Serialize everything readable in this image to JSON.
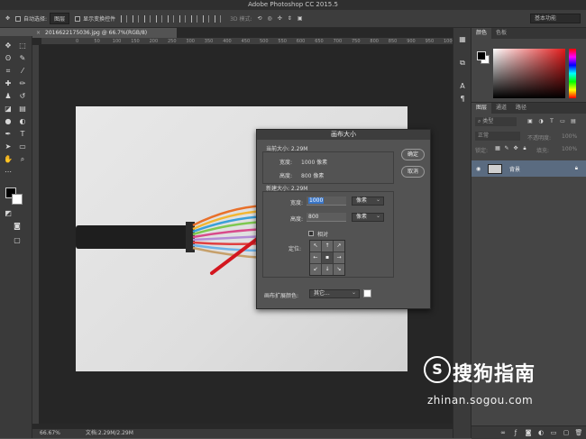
{
  "app": {
    "title": "Adobe Photoshop CC 2015.5"
  },
  "options_bar": {
    "auto_select_label": "自动选择:",
    "auto_select_value": "图层",
    "show_transform_label": "显示变换控件",
    "mode_label": "3D 模式:",
    "workspace": "基本功能"
  },
  "document": {
    "tab_title": "2016622175036.jpg @ 66.7%(RGB/8)",
    "close_glyph": "×",
    "ruler_marks": [
      "0",
      "50",
      "100",
      "150",
      "200",
      "250",
      "300",
      "350",
      "400",
      "450",
      "500",
      "550",
      "600",
      "650",
      "700",
      "750",
      "800",
      "850",
      "900",
      "950",
      "1000",
      "1050"
    ]
  },
  "status": {
    "zoom": "66.67%",
    "doc_size": "文档:2.29M/2.29M"
  },
  "panels": {
    "color_tabs": [
      "颜色",
      "色板"
    ],
    "layers_tabs": [
      "图层",
      "通道",
      "路径"
    ],
    "kind_label": "类型",
    "blend_mode": "正常",
    "opacity_label": "不透明度:",
    "opacity_value": "100%",
    "lock_label": "锁定:",
    "fill_label": "填充:",
    "fill_value": "100%",
    "layer_name": "背景"
  },
  "dialog": {
    "title": "画布大小",
    "current_size": "当前大小: 2.29M",
    "current_width_label": "宽度:",
    "current_width_value": "1000 像素",
    "current_height_label": "高度:",
    "current_height_value": "800 像素",
    "new_size": "新建大小: 2.29M",
    "new_width_label": "宽度:",
    "new_width_value": "1000",
    "new_height_label": "高度:",
    "new_height_value": "800",
    "unit_value": "像素",
    "relative_label": "相对",
    "anchor_label": "定位:",
    "anchor_arrows": [
      "↖",
      "↑",
      "↗",
      "←",
      "",
      "→",
      "↙",
      "↓",
      "↘"
    ],
    "ext_color_label": "画布扩展颜色:",
    "ext_color_value": "其它...",
    "ok_label": "确定",
    "cancel_label": "取消"
  },
  "watermark": {
    "logo_glyph": "S",
    "brand": "搜狗指南",
    "url": "zhinan.sogou.com"
  }
}
